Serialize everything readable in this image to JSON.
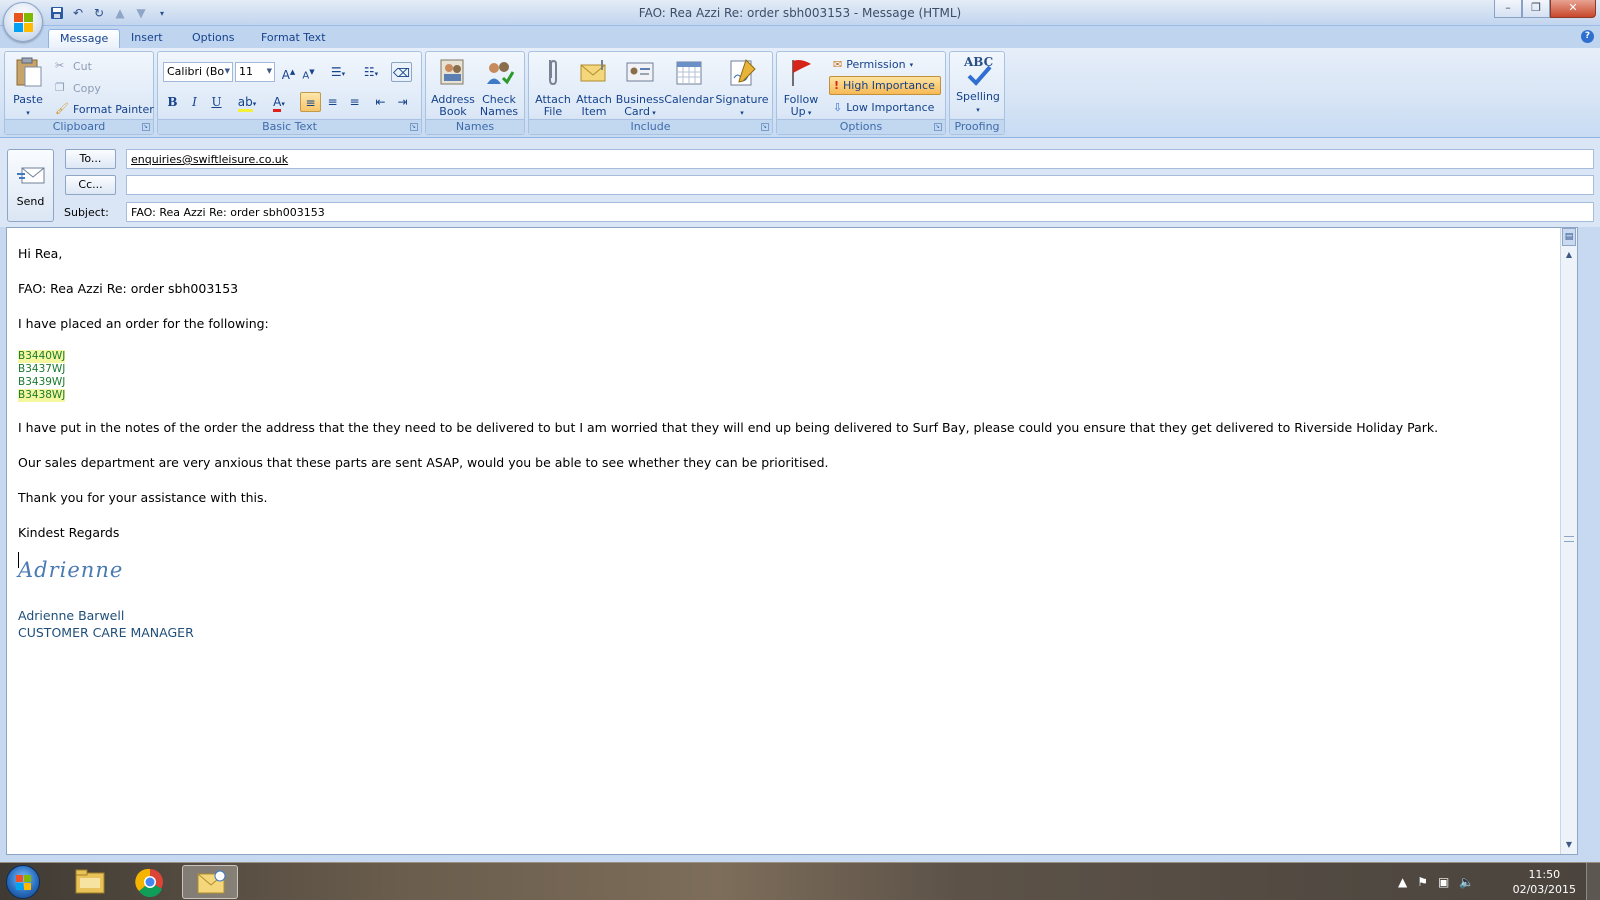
{
  "window": {
    "title": "FAO: Rea Azzi  Re: order sbh003153  - Message (HTML)"
  },
  "tabs": [
    "Message",
    "Insert",
    "Options",
    "Format Text"
  ],
  "ribbon": {
    "clipboard": {
      "paste": "Paste",
      "cut": "Cut",
      "copy": "Copy",
      "format_painter": "Format Painter",
      "label": "Clipboard"
    },
    "basic_text": {
      "font": "Calibri (Bo",
      "size": "11",
      "label": "Basic Text"
    },
    "names": {
      "address_book_1": "Address",
      "address_book_2": "Book",
      "check_names_1": "Check",
      "check_names_2": "Names",
      "label": "Names"
    },
    "include": {
      "attach_file_1": "Attach",
      "attach_file_2": "File",
      "attach_item_1": "Attach",
      "attach_item_2": "Item",
      "business_card_1": "Business",
      "business_card_2": "Card",
      "calendar": "Calendar",
      "signature": "Signature",
      "label": "Include"
    },
    "options": {
      "follow_up_1": "Follow",
      "follow_up_2": "Up",
      "permission": "Permission",
      "high_importance": "High Importance",
      "low_importance": "Low Importance",
      "label": "Options"
    },
    "proofing": {
      "spelling_icon_text": "ABC",
      "spelling": "Spelling",
      "label": "Proofing"
    },
    "format_buttons": {
      "bold": "B",
      "italic": "I",
      "underline": "U",
      "font_color": "A"
    }
  },
  "header": {
    "send": "Send",
    "to_button": "To...",
    "cc_button": "Cc...",
    "subject_label": "Subject:",
    "to_value": "enquiries@swiftleisure.co.uk",
    "cc_value": "",
    "subject_value": "FAO: Rea Azzi  Re: order sbh003153"
  },
  "body": {
    "greeting": "Hi Rea,",
    "ref": "FAO: Rea Azzi  Re: order sbh003153",
    "intro": "I have placed an order for the following:",
    "codes": [
      "B3440WJ",
      "B3437WJ",
      "B3439WJ",
      "B3438WJ"
    ],
    "para1": "I have put in the notes of the order the address that the they need to be delivered to but I am worried that they will end up being delivered to Surf Bay, please could you ensure that they get delivered to Riverside Holiday Park.",
    "para2": "Our sales department are very anxious that these parts are sent ASAP, would you be able to see whether they can be prioritised.",
    "para3": "Thank you for your assistance with this.",
    "closing": "Kindest Regards",
    "signature_script": "Adrienne",
    "sig_name": "Adrienne Barwell",
    "sig_title": "CUSTOMER CARE MANAGER"
  },
  "taskbar": {
    "time": "11:50",
    "date": "02/03/2015"
  },
  "colors": {
    "ribbon_bg": "#d6e4f5",
    "highlight": "#f4f7a0",
    "code_green": "#1a7a2e",
    "signature_blue": "#4a7ab4"
  }
}
